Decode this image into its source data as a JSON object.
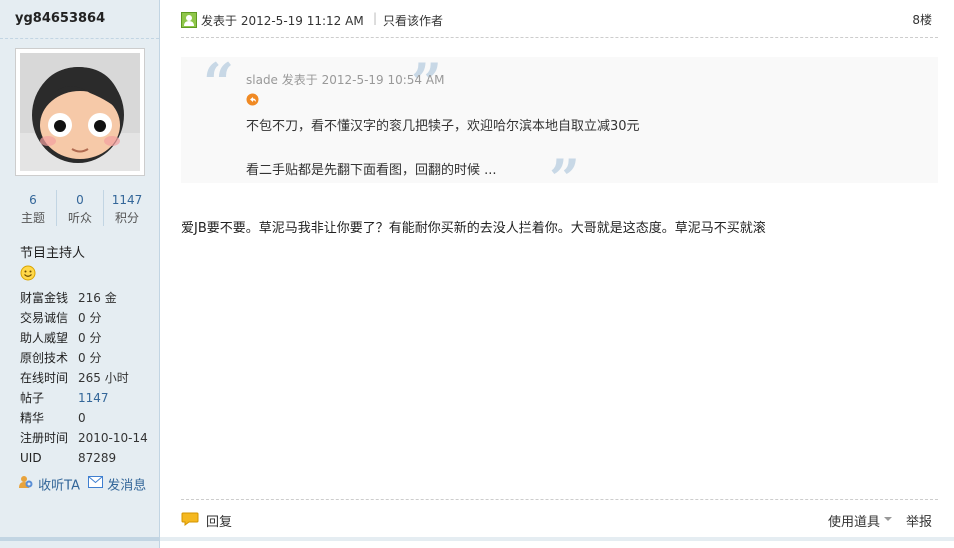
{
  "user": {
    "name": "yg84653864",
    "stats": [
      {
        "value": "6",
        "label": "主题"
      },
      {
        "value": "0",
        "label": "听众"
      },
      {
        "value": "1147",
        "label": "积分"
      }
    ],
    "group": "节目主持人",
    "info": [
      {
        "key": "财富金钱",
        "value": "216 金"
      },
      {
        "key": "交易诚信",
        "value": "0 分"
      },
      {
        "key": "助人威望",
        "value": "0 分"
      },
      {
        "key": "原创技术",
        "value": "0 分"
      },
      {
        "key": "在线时间",
        "value": "265 小时"
      },
      {
        "key": "帖子",
        "value": "1147"
      },
      {
        "key": "精华",
        "value": "0"
      },
      {
        "key": "注册时间",
        "value": "2010-10-14"
      },
      {
        "key": "UID",
        "value": "87289"
      }
    ],
    "follow_label": "收听TA",
    "message_label": "发消息"
  },
  "post": {
    "posted_at": "发表于 2012-5-19 11:12 AM",
    "author_only": "只看该作者",
    "floor": "8楼",
    "quote": {
      "author": "slade 发表于 2012-5-19 10:54 AM",
      "line1": "不包不刀，看不懂汉字的衮几把犊子，欢迎哈尔滨本地自取立减30元",
      "line2": "看二手贴都是先翻下面看图，回翻的时候 ..."
    },
    "body": "爱JB要不要。草泥马我非让你要了？有能耐你买新的去没人拦着你。大哥就是这态度。草泥马不买就滚"
  },
  "footer": {
    "reply": "回复",
    "tools": "使用道具",
    "report": "举报"
  }
}
